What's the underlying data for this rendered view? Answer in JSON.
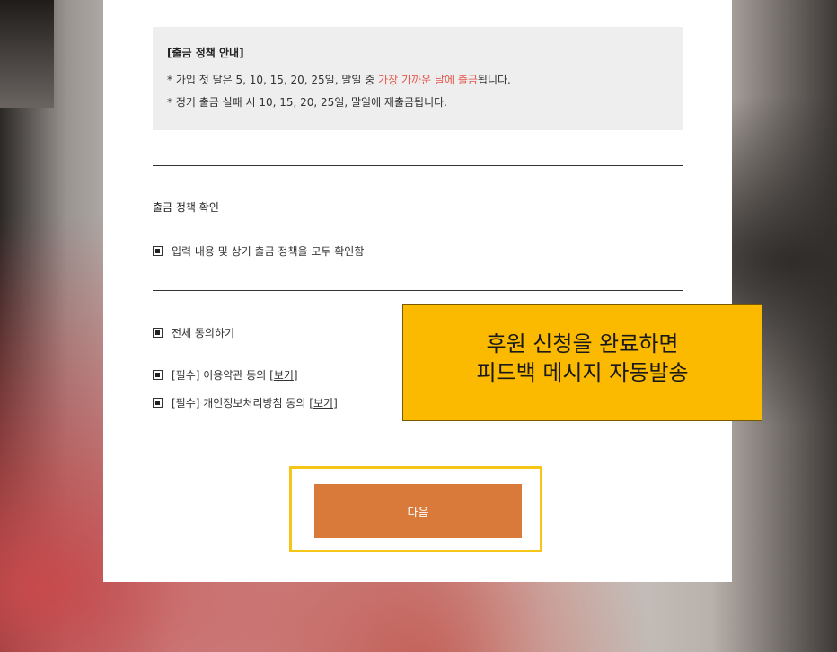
{
  "policy": {
    "title": "[출금 정책 안내]",
    "line1_prefix": "* 가입 첫 달은 5, 10, 15, 20, 25일, 말일 중 ",
    "line1_highlight": "가장 가까운 날에 출금",
    "line1_suffix": "됩니다.",
    "line2": "* 정기 출금 실패 시 10, 15, 20, 25일, 말일에 재출금됩니다."
  },
  "confirm_section": {
    "title": "출금 정책 확인",
    "confirm_label": "입력 내용 및 상기 출금 정책을 모두 확인함"
  },
  "agreements": {
    "all_label": "전체 동의하기",
    "terms_prefix": "[필수] 이용약관 동의 [",
    "terms_link": "보기",
    "terms_suffix": "]",
    "privacy_prefix": "[필수] 개인정보처리방침 동의 [",
    "privacy_link": "보기",
    "privacy_suffix": "]"
  },
  "next_button": {
    "label": "다음"
  },
  "callout": {
    "line1": "후원 신청을 완료하면",
    "line2": "피드백 메시지 자동발송"
  },
  "colors": {
    "accent_button": "#d97a3b",
    "highlight_text": "#e2574c",
    "callout_bg": "#fbb900",
    "highlight_border": "#f5c518"
  }
}
